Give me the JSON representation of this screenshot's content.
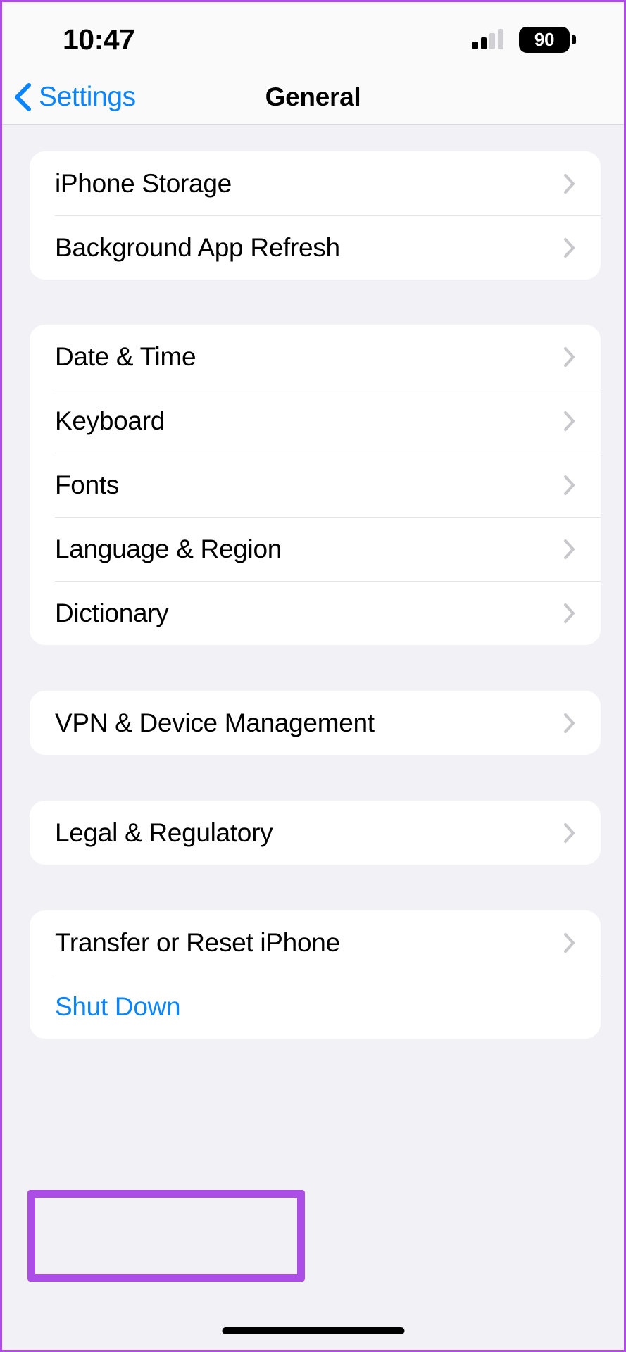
{
  "status_bar": {
    "time": "10:47",
    "signal_icon": "cellular-signal-icon",
    "signal_bars_filled": 2,
    "signal_bars_total": 4,
    "battery_icon": "battery-icon",
    "battery_level": "90"
  },
  "nav": {
    "back_icon": "chevron-left-icon",
    "back_label": "Settings",
    "title": "General"
  },
  "colors": {
    "accent_blue": "#0A84FF",
    "background": "#F2F1F6",
    "card": "#FFFFFF",
    "chevron": "#C7C7CC",
    "annotation": "#AC4DE8"
  },
  "groups": [
    {
      "rows": [
        {
          "label": "iPhone Storage",
          "accessory": "chevron-right-icon",
          "style": "default"
        },
        {
          "label": "Background App Refresh",
          "accessory": "chevron-right-icon",
          "style": "default"
        }
      ]
    },
    {
      "rows": [
        {
          "label": "Date & Time",
          "accessory": "chevron-right-icon",
          "style": "default"
        },
        {
          "label": "Keyboard",
          "accessory": "chevron-right-icon",
          "style": "default"
        },
        {
          "label": "Fonts",
          "accessory": "chevron-right-icon",
          "style": "default"
        },
        {
          "label": "Language & Region",
          "accessory": "chevron-right-icon",
          "style": "default"
        },
        {
          "label": "Dictionary",
          "accessory": "chevron-right-icon",
          "style": "default"
        }
      ]
    },
    {
      "rows": [
        {
          "label": "VPN & Device Management",
          "accessory": "chevron-right-icon",
          "style": "default"
        }
      ]
    },
    {
      "rows": [
        {
          "label": "Legal & Regulatory",
          "accessory": "chevron-right-icon",
          "style": "default"
        }
      ]
    },
    {
      "rows": [
        {
          "label": "Transfer or Reset iPhone",
          "accessory": "chevron-right-icon",
          "style": "default"
        },
        {
          "label": "Shut Down",
          "accessory": "none",
          "style": "link"
        }
      ]
    }
  ],
  "annotation": {
    "target_label": "Transfer or Reset iPhone",
    "shape": "rectangle-highlight"
  },
  "home_indicator": "home-indicator-bar"
}
